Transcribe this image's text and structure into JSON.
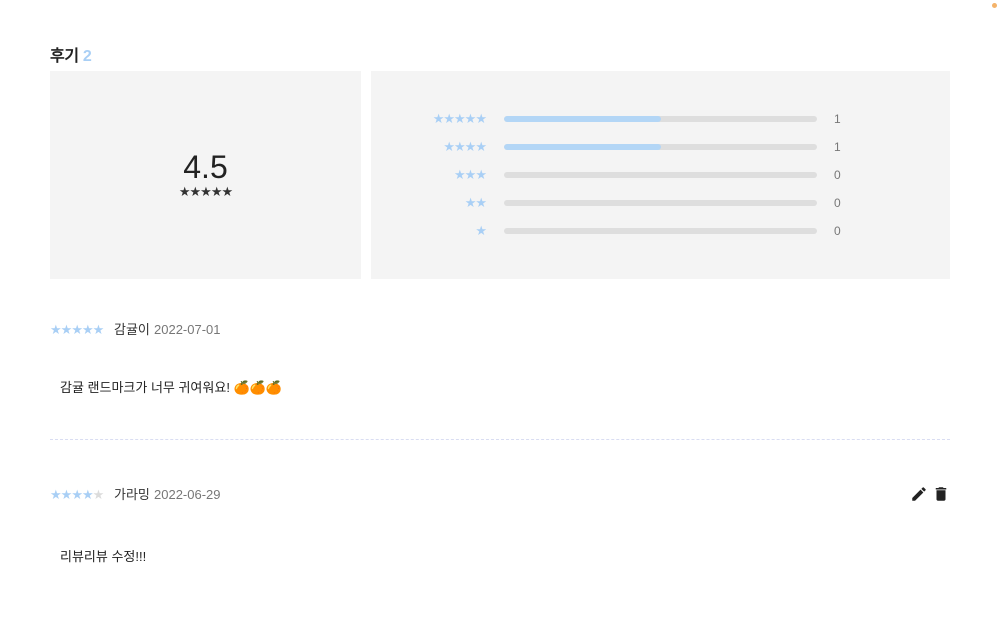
{
  "reviews_section": {
    "title": "후기",
    "count": "2"
  },
  "summary": {
    "average": "4.5",
    "average_stars": "★★★★★",
    "distribution": [
      {
        "stars": "★★★★★",
        "count": "1",
        "fraction": 0.5
      },
      {
        "stars": "★★★★",
        "count": "1",
        "fraction": 0.5
      },
      {
        "stars": "★★★",
        "count": "0",
        "fraction": 0
      },
      {
        "stars": "★★",
        "count": "0",
        "fraction": 0
      },
      {
        "stars": "★",
        "count": "0",
        "fraction": 0
      }
    ]
  },
  "reviews": [
    {
      "rating": 5,
      "author": "감귤이",
      "date": "2022-07-01",
      "text": "감귤 랜드마크가 너무 귀여워요! 🍊🍊🍊"
    },
    {
      "rating": 4,
      "author": "가라밍",
      "date": "2022-06-29",
      "text": "리뷰리뷰 수정!!!",
      "actions": {
        "edit_icon": "pencil-icon",
        "delete_icon": "trash-icon"
      }
    }
  ],
  "colors": {
    "accent": "#a9cff5",
    "bar_fill": "#b3d6f6",
    "panel_bg": "#f4f4f4"
  }
}
